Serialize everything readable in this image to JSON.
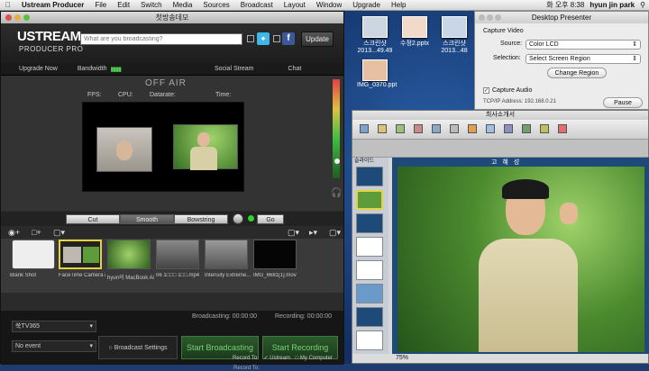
{
  "menubar": {
    "app": "Ustream Producer",
    "items": [
      "File",
      "Edit",
      "Switch",
      "Media",
      "Sources",
      "Broadcast",
      "Layout",
      "Window",
      "Upgrade",
      "Help"
    ],
    "clock": "화 오후 8:38",
    "user": "hyun jin park"
  },
  "producer": {
    "title": "첫방송데모",
    "logo_top": "USTREAM",
    "logo_bottom": "PRODUCER PRO",
    "broadcast_placeholder": "What are you broadcasting?",
    "update_label": "Update",
    "nav": {
      "upgrade": "Upgrade Now",
      "bandwidth": "Bandwidth",
      "social": "Social Stream",
      "chat": "Chat"
    },
    "status": "OFF AIR",
    "stats": {
      "fps": "FPS:",
      "cpu": "CPU:",
      "datarate": "Datarate:",
      "time": "Time:"
    },
    "transitions": {
      "cut": "Cut",
      "smooth": "Smooth",
      "bowstring": "Bowstring",
      "go": "Go"
    },
    "media": [
      {
        "label": "Blank Shot"
      },
      {
        "label": "FaceTime Camera (..."
      },
      {
        "label": "hyun의 MacBook Ai..."
      },
      {
        "label": "06 1□□□ 1□□.mp4"
      },
      {
        "label": "Intensity Extreme..."
      },
      {
        "label": "IMG_6681[1].mov"
      }
    ],
    "broadcasting": "Broadcasting: 00:00:00",
    "recording": "Recording: 00:00:00",
    "channel": "쑥TV365",
    "event": "No event",
    "broadcast_settings": "Broadcast Settings",
    "start_broadcasting": "Start Broadcasting",
    "start_recording": "Start Recording",
    "record_to": "Record To:",
    "record_ustream": "Ustream",
    "record_computer": "My Computer"
  },
  "desktop": {
    "icons": [
      "스크린샷 2013...49.49",
      "수정2.pptx",
      "스크린샷 2013...48",
      "IMG_0370.ppt"
    ]
  },
  "presenter": {
    "title": "Desktop Presenter",
    "capture_video": "Capture Video",
    "source_label": "Source:",
    "source_value": "Color LCD",
    "selection_label": "Selection:",
    "selection_value": "Select Screen Region",
    "change_region": "Change Region",
    "capture_audio": "Capture Audio",
    "ip": "TCP/IP Address: 192.168.0.21",
    "pause": "Pause"
  },
  "ppt": {
    "title": "최사소개서",
    "slide_title": "고 혜 성",
    "pane_label": "슬라이드",
    "zoom": "75%"
  },
  "colors": {
    "green": "#7bd27b",
    "ustream_blue": "#2a73c6"
  }
}
